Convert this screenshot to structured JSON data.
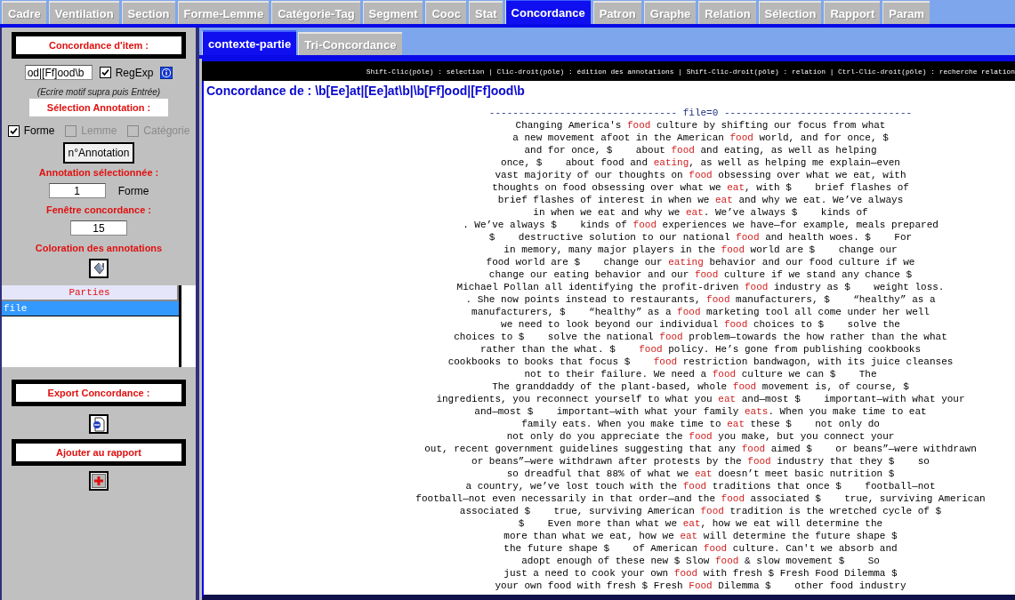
{
  "tabs": [
    {
      "label": "Cadre",
      "selected": false
    },
    {
      "label": "Ventilation",
      "selected": false
    },
    {
      "label": "Section",
      "selected": false
    },
    {
      "label": "Forme-Lemme",
      "selected": false
    },
    {
      "label": "Catégorie-Tag",
      "selected": false
    },
    {
      "label": "Segment",
      "selected": false
    },
    {
      "label": "Cooc",
      "selected": false
    },
    {
      "label": "Stat",
      "selected": false
    },
    {
      "label": "Concordance",
      "selected": true
    },
    {
      "label": "Patron",
      "selected": false
    },
    {
      "label": "Graphe",
      "selected": false
    },
    {
      "label": "Relation",
      "selected": false
    },
    {
      "label": "Sélection",
      "selected": false
    },
    {
      "label": "Rapport",
      "selected": false
    },
    {
      "label": "Param",
      "selected": false
    }
  ],
  "left_panel": {
    "item_title": "Concordance d'item :",
    "pattern": {
      "value": "od|[Ff]ood\\b"
    },
    "regexp": {
      "label": "RegExp",
      "checked": true
    },
    "hint": "(Ecrire motif supra puis Entrée)",
    "annotation_title": "Sélection Annotation :",
    "annotation_options": [
      {
        "label": "Forme",
        "checked": true,
        "disabled": false
      },
      {
        "label": "Lemme",
        "checked": false,
        "disabled": true
      },
      {
        "label": "Catégorie",
        "checked": false,
        "disabled": true
      }
    ],
    "annotation_button": "n°Annotation",
    "selected_annotation_label": "Annotation sélectionnée :",
    "selected_annotation": {
      "value": "1",
      "unit": "Forme"
    },
    "window_label": "Fenêtre concordance :",
    "window": {
      "value": "15"
    },
    "coloring_label": "Coloration des annotations",
    "parts": {
      "header": "Parties",
      "items": [
        {
          "label": "file",
          "selected": true
        }
      ]
    },
    "export_title": "Export Concordance :",
    "report_title": "Ajouter au rapport"
  },
  "subtabs": [
    {
      "label": "contexte-partie",
      "selected": true
    },
    {
      "label": "Tri-Concordance",
      "selected": false
    }
  ],
  "help_bar": "Shift-Clic(pôle) : sélection | Clic-droit(pôle) : édition des annotations | Shift-Clic-droit(pôle) : relation | Ctrl-Clic-droit(pôle) : recherche relation",
  "concordance": {
    "title": "Concordance de : \\b[Ee]at|[Ee]at\\b|\\b[Ff]ood|[Ff]ood\\b",
    "separator": "-------------------------------- file=0 --------------------------------",
    "lines": [
      {
        "left": "Changing America's",
        "pivot": "food",
        "right": "culture by shifting our focus from what"
      },
      {
        "left": "a new movement afoot in the American",
        "pivot": "food",
        "right": "world, and for once, $"
      },
      {
        "left": "and for once, $    about",
        "pivot": "food",
        "right": "and eating, as well as helping"
      },
      {
        "left": "once, $    about food and",
        "pivot": "eating",
        "right": ", as well as helping me explain—even"
      },
      {
        "left": "vast majority of our thoughts on",
        "pivot": "food",
        "right": "obsessing over what we eat, with"
      },
      {
        "left": "thoughts on food obsessing over what we",
        "pivot": "eat",
        "right": ", with $    brief flashes of"
      },
      {
        "left": "brief flashes of interest in when we",
        "pivot": "eat",
        "right": "and why we eat. We’ve always"
      },
      {
        "left": "in when we eat and why we",
        "pivot": "eat",
        "right": ". We’ve always $    kinds of"
      },
      {
        "left": ". We’ve always $    kinds of",
        "pivot": "food",
        "right": "experiences we have—for example, meals prepared"
      },
      {
        "left": "$    destructive solution to our national",
        "pivot": "food",
        "right": "and health woes. $    For"
      },
      {
        "left": "in memory, many major players in the",
        "pivot": "food",
        "right": "world are $    change our"
      },
      {
        "left": "food world are $    change our",
        "pivot": "eating",
        "right": "behavior and our food culture if we"
      },
      {
        "left": "change our eating behavior and our",
        "pivot": "food",
        "right": "culture if we stand any chance $"
      },
      {
        "left": "Michael Pollan all identifying the profit-driven",
        "pivot": "food",
        "right": "industry as $    weight loss."
      },
      {
        "left": ". She now points instead to restaurants,",
        "pivot": "food",
        "right": "manufacturers, $    “healthy” as a"
      },
      {
        "left": "manufacturers, $    “healthy” as a",
        "pivot": "food",
        "right": "marketing tool all come under her well"
      },
      {
        "left": "we need to look beyond our individual",
        "pivot": "food",
        "right": "choices to $    solve the"
      },
      {
        "left": "choices to $    solve the national",
        "pivot": "food",
        "right": "problem—towards the how rather than the what"
      },
      {
        "left": "rather than the what. $   ",
        "pivot": "food",
        "right": "policy. He’s gone from publishing cookbooks"
      },
      {
        "left": "cookbooks to books that focus $   ",
        "pivot": "food",
        "right": "restriction bandwagon, with its juice cleanses"
      },
      {
        "left": "not to their failure. We need a",
        "pivot": "food",
        "right": "culture we can $    The"
      },
      {
        "left": "The granddaddy of the plant-based, whole",
        "pivot": "food",
        "right": "movement is, of course, $"
      },
      {
        "left": "ingredients, you reconnect yourself to what you",
        "pivot": "eat",
        "right": "and—most $    important—with what your"
      },
      {
        "left": "and—most $    important—with what your family",
        "pivot": "eats",
        "right": ". When you make time to eat"
      },
      {
        "left": "family eats. When you make time to",
        "pivot": "eat",
        "right": "these $    not only do"
      },
      {
        "left": "not only do you appreciate the",
        "pivot": "food",
        "right": "you make, but you connect your"
      },
      {
        "left": "out, recent government guidelines suggesting that any",
        "pivot": "food",
        "right": "aimed $    or beans”—were withdrawn"
      },
      {
        "left": "or beans”—were withdrawn after protests by the",
        "pivot": "food",
        "right": "industry that they $    so"
      },
      {
        "left": "so dreadful that 88% of what we",
        "pivot": "eat",
        "right": "doesn’t meet basic nutrition $"
      },
      {
        "left": "a country, we’ve lost touch with the",
        "pivot": "food",
        "right": "traditions that once $    football—not"
      },
      {
        "left": "football—not even necessarily in that order—and the",
        "pivot": "food",
        "right": "associated $    true, surviving American"
      },
      {
        "left": "associated $    true, surviving American",
        "pivot": "food",
        "right": "tradition is the wretched cycle of $"
      },
      {
        "left": "$    Even more than what we",
        "pivot": "eat",
        "right": ", how we eat will determine the"
      },
      {
        "left": "more than what we eat, how we",
        "pivot": "eat",
        "right": "will determine the future shape $"
      },
      {
        "left": "the future shape $    of American",
        "pivot": "food",
        "right": "culture. Can't we absorb and"
      },
      {
        "left": "adopt enough of these new $ Slow",
        "pivot": "food",
        "right": "& slow movement $    So"
      },
      {
        "left": "just a need to cook your own",
        "pivot": "food",
        "right": "with fresh $ Fresh Food Dilemma $"
      },
      {
        "left": "your own food with fresh $ Fresh",
        "pivot": "Food",
        "right": "Dilemma $    other food industry"
      }
    ]
  }
}
